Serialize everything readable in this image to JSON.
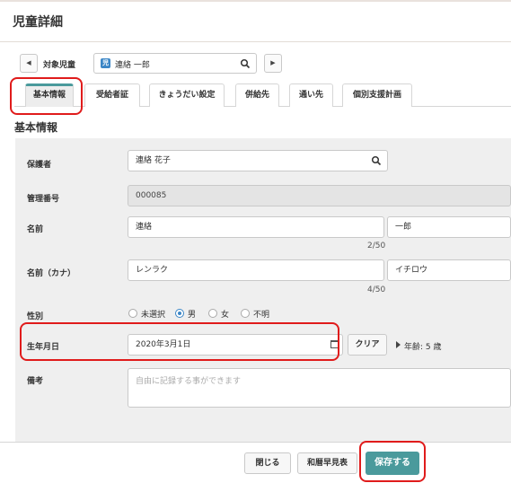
{
  "header": {
    "title": "児童詳細"
  },
  "child_selector": {
    "label": "対象児童",
    "badge": "児",
    "selected": "連絡 一郎",
    "prev": "◀",
    "next": "▶"
  },
  "tabs": [
    {
      "label": "基本情報",
      "active": true
    },
    {
      "label": "受給者証",
      "active": false
    },
    {
      "label": "きょうだい設定",
      "active": false
    },
    {
      "label": "併給先",
      "active": false
    },
    {
      "label": "通い先",
      "active": false
    },
    {
      "label": "個別支援計画",
      "active": false
    }
  ],
  "section": {
    "title": "基本情報"
  },
  "form": {
    "guardian": {
      "label": "保護者",
      "value": "連絡 花子"
    },
    "admin_number": {
      "label": "管理番号",
      "value": "000085"
    },
    "name": {
      "label": "名前",
      "last": "連絡",
      "first": "一郎",
      "counter": "2/50"
    },
    "kana": {
      "label": "名前（カナ）",
      "last": "レンラク",
      "first": "イチロウ",
      "counter": "4/50"
    },
    "gender": {
      "label": "性別",
      "options": [
        "未選択",
        "男",
        "女",
        "不明"
      ],
      "selected": "男"
    },
    "birthday": {
      "label": "生年月日",
      "value": "2020年3月1日",
      "clear_label": "クリア",
      "age": "年齢: 5 歳"
    },
    "remarks": {
      "label": "備考",
      "placeholder": "自由に記録する事ができます"
    }
  },
  "footer": {
    "close_label": "閉じる",
    "calendar_label": "和暦早見表",
    "save_label": "保存する"
  },
  "colors": {
    "accent": "#4a9a9c",
    "highlight": "#e01b1b",
    "badge": "#3b86c6"
  }
}
